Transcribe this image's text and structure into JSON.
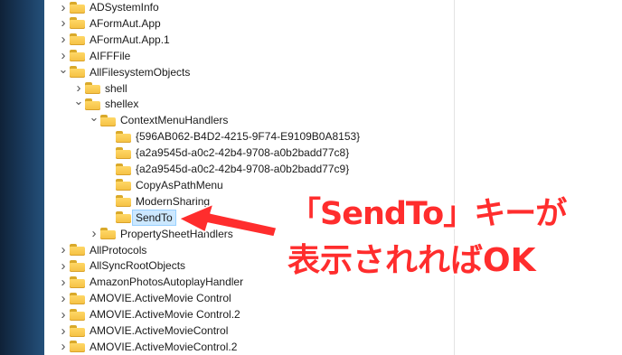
{
  "tree": {
    "items": [
      {
        "label": "ADSystemInfo",
        "level": 0,
        "chevron": "right"
      },
      {
        "label": "AFormAut.App",
        "level": 0,
        "chevron": "right"
      },
      {
        "label": "AFormAut.App.1",
        "level": 0,
        "chevron": "right"
      },
      {
        "label": "AIFFFile",
        "level": 0,
        "chevron": "right"
      },
      {
        "label": "AllFilesystemObjects",
        "level": 0,
        "chevron": "down"
      },
      {
        "label": "shell",
        "level": 1,
        "chevron": "right"
      },
      {
        "label": "shellex",
        "level": 1,
        "chevron": "down"
      },
      {
        "label": "ContextMenuHandlers",
        "level": 2,
        "chevron": "down"
      },
      {
        "label": "{596AB062-B4D2-4215-9F74-E9109B0A8153}",
        "level": 3,
        "chevron": ""
      },
      {
        "label": "{a2a9545d-a0c2-42b4-9708-a0b2badd77c8}",
        "level": 3,
        "chevron": ""
      },
      {
        "label": "{a2a9545d-a0c2-42b4-9708-a0b2badd77c9}",
        "level": 3,
        "chevron": ""
      },
      {
        "label": "CopyAsPathMenu",
        "level": 3,
        "chevron": ""
      },
      {
        "label": "ModernSharing",
        "level": 3,
        "chevron": ""
      },
      {
        "label": "SendTo",
        "level": 3,
        "chevron": "",
        "selected": true
      },
      {
        "label": "PropertySheetHandlers",
        "level": 2,
        "chevron": "right"
      },
      {
        "label": "AllProtocols",
        "level": 0,
        "chevron": "right"
      },
      {
        "label": "AllSyncRootObjects",
        "level": 0,
        "chevron": "right"
      },
      {
        "label": "AmazonPhotosAutoplayHandler",
        "level": 0,
        "chevron": "right"
      },
      {
        "label": "AMOVIE.ActiveMovie Control",
        "level": 0,
        "chevron": "right"
      },
      {
        "label": "AMOVIE.ActiveMovie Control.2",
        "level": 0,
        "chevron": "right"
      },
      {
        "label": "AMOVIE.ActiveMovieControl",
        "level": 0,
        "chevron": "right"
      },
      {
        "label": "AMOVIE.ActiveMovieControl.2",
        "level": 0,
        "chevron": "right"
      }
    ]
  },
  "annotation": {
    "line1": "「SendTo」キーが",
    "line2": "表示されればOK",
    "color": "#ff2d2d"
  }
}
